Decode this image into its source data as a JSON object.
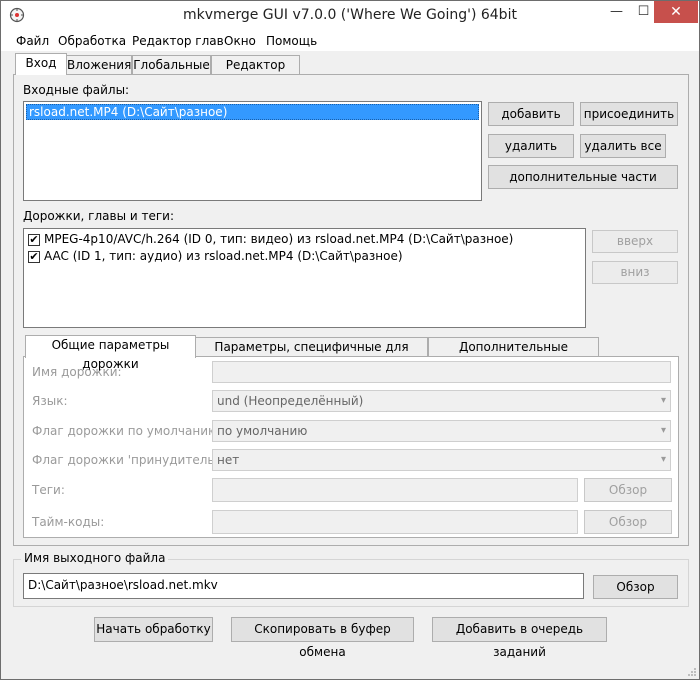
{
  "window": {
    "title": "mkvmerge GUI v7.0.0 ('Where We Going') 64bit",
    "minimize": "—",
    "maximize": "☐",
    "close": "✕"
  },
  "menu": [
    "Файл",
    "Обработка",
    "Редактор глав",
    "Окно",
    "Помощь"
  ],
  "main_tabs": [
    "Вход",
    "Вложения",
    "Глобальные",
    "Редактор глав"
  ],
  "input": {
    "label": "Входные файлы:",
    "files": [
      "rsload.net.MP4 (D:\\Сайт\\разное)"
    ],
    "buttons": {
      "add": "добавить",
      "append": "присоединить",
      "remove": "удалить",
      "remove_all": "удалить все",
      "additional": "дополнительные части"
    }
  },
  "tracks": {
    "label": "Дорожки, главы и теги:",
    "items": [
      {
        "checked": true,
        "text": "MPEG-4p10/AVC/h.264 (ID 0, тип: видео) из rsload.net.MP4 (D:\\Сайт\\разное)"
      },
      {
        "checked": true,
        "text": "AAC (ID 1, тип: аудио) из rsload.net.MP4 (D:\\Сайт\\разное)"
      }
    ],
    "up": "вверх",
    "down": "вниз"
  },
  "track_tabs": [
    "Общие параметры дорожки",
    "Параметры, специфичные для формата",
    "Дополнительные параметры"
  ],
  "track_params": {
    "name_label": "Имя дорожки:",
    "language_label": "Язык:",
    "language_value": "und (Неопределённый)",
    "default_flag_label": "Флаг дорожки по умолчанию:",
    "default_flag_value": "по умолчанию",
    "forced_flag_label": "Флаг дорожки 'принудительно':",
    "forced_flag_value": "нет",
    "tags_label": "Теги:",
    "tags_browse": "Обзор",
    "timecodes_label": "Тайм-коды:",
    "timecodes_browse": "Обзор"
  },
  "output": {
    "label": "Имя выходного файла",
    "value": "D:\\Сайт\\разное\\rsload.net.mkv",
    "browse": "Обзор"
  },
  "actions": {
    "start": "Начать обработку",
    "copy": "Скопировать в буфер обмена",
    "queue": "Добавить в очередь заданий"
  },
  "colors": {
    "selection": "#3399ff",
    "close_button": "#c7504c"
  }
}
